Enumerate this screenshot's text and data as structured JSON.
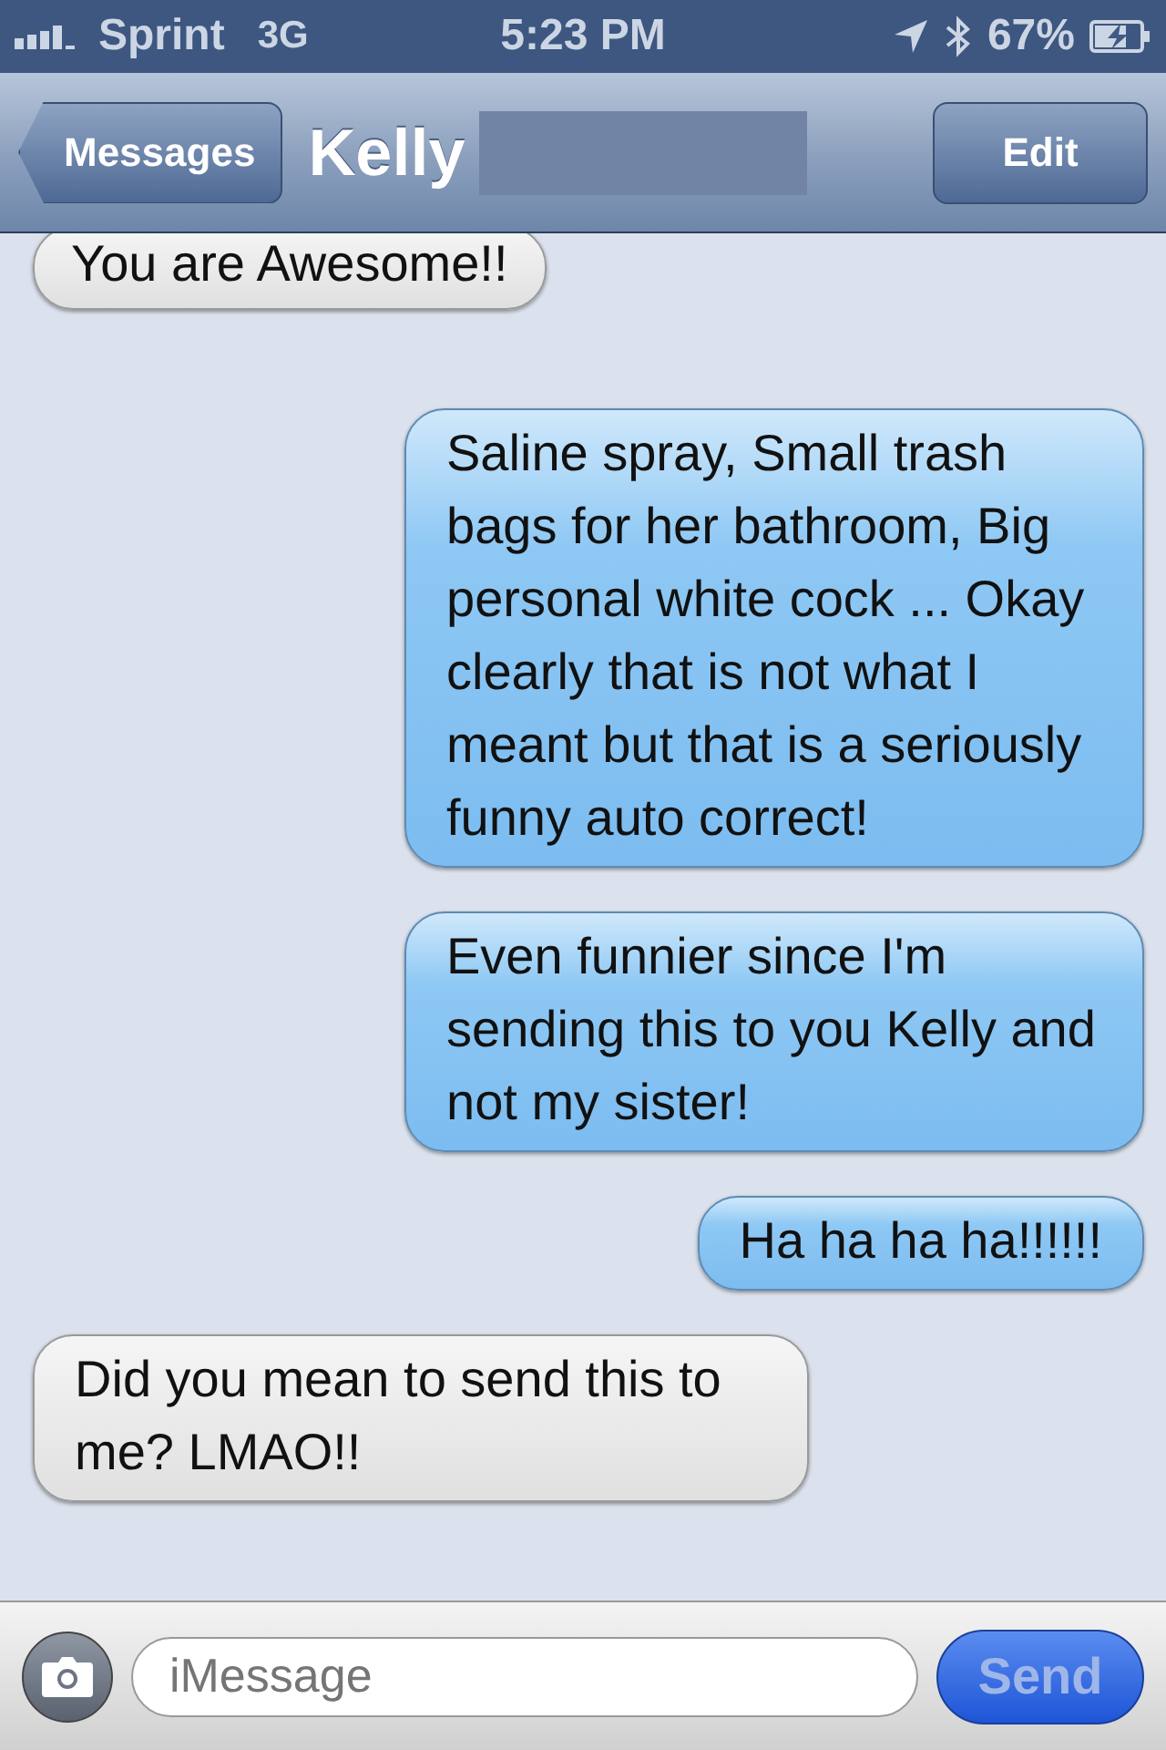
{
  "status_bar": {
    "carrier": "Sprint",
    "network": "3G",
    "time": "5:23 PM",
    "battery": "67%"
  },
  "nav_bar": {
    "back": "Messages",
    "title": "Kelly",
    "title_redacted": true,
    "action": "Edit"
  },
  "messages": [
    {
      "kind": "incoming",
      "text": "You are Awesome!!"
    },
    {
      "kind": "outgoing",
      "text": "Saline spray, Small trash bags for her bathroom, Big personal white cock ... Okay clearly that is not what I meant but that is a seriously funny auto correct!"
    },
    {
      "kind": "outgoing",
      "text": "Even funnier since I'm sending this to you Kelly and not my sister!"
    },
    {
      "kind": "outgoing",
      "text": "Ha ha ha ha!!!!!!"
    },
    {
      "kind": "incoming",
      "text": "Did you mean to send this to me? LMAO!!"
    }
  ],
  "composer": {
    "placeholder": "iMessage",
    "send": "Send",
    "send_disabled": true
  }
}
